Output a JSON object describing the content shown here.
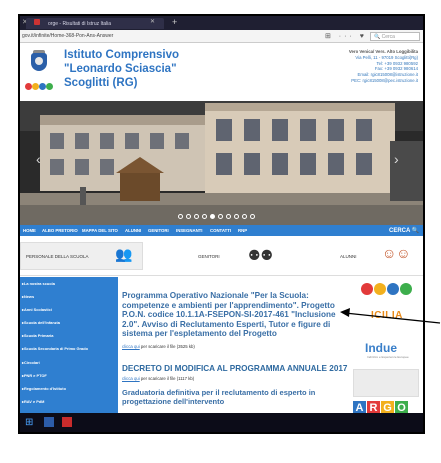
{
  "browser": {
    "tab_title": "orge - Risultati di Istruz Italia",
    "tab_close": "✕",
    "new_tab": "+",
    "url": "gov.it/infinite/Home-368-Pon-Ans-Answer",
    "toolbar_icons": "⊞ ··· ♥ ☆",
    "search_placeholder": "🔍 Cerca"
  },
  "header": {
    "school_line1": "Istituto Comprensivo",
    "school_line2": "\"Leonardo Sciascia\"",
    "school_line3": "Scoglitti (RG)",
    "contact_name": "Vero Venica/ Vers. Alto Loggibilita",
    "contact_lines": [
      "Via Pelli, 11 - 97019 Scoglitti(Rg)",
      "Tel: +39 0932 980592",
      "Fax: +39 0932 980614",
      "Email: rgic815008@istruzione.it",
      "PEC: rgic815008@pec.istruzione.it"
    ],
    "logo_dot_colors": [
      "#e23a3a",
      "#f2b01e",
      "#2e74c2",
      "#3dae4c"
    ]
  },
  "slider": {
    "prev": "‹",
    "next": "›",
    "page_count": 10,
    "active_page": 5
  },
  "nav": {
    "items": [
      "HOME",
      "ALBO PRETORIO",
      "MAPPA DEL SITO",
      "ALUNNI",
      "GENITORI",
      "INSEGNANTI",
      "CONTATTI",
      "RNP"
    ],
    "search_label": "CERCA 🔍"
  },
  "quick": {
    "personale": "PERSONALE DELLA SCUOLA",
    "genitori": "GENITORI",
    "alunni": "ALUNNI"
  },
  "sidebar": {
    "items": [
      "▸La nostra scuola",
      "▸News",
      "▸Anni Scolastici",
      "▸Scuola dell'Infanzia",
      "▸Scuola Primaria",
      "▸Scuola Secondaria di Primo Grado",
      "▸Circolari",
      "▸PNR e PTOF",
      "▸Regolamento d'Istituto",
      "▸RAV e PdM"
    ]
  },
  "content": {
    "article1_title": "Programma Operativo Nazionale \"Per la Scuola: competenze e ambienti per l'apprendimento\". Progetto P.O.N. codice 10.1.1A-FSEPON-SI-2017-461 \"Inclusione 2.0\". Avviso di Reclutamento Esperti, Tutor e figure di sistema per l'espletamento del Progetto",
    "article1_link": "clicca qui",
    "article1_suffix": " per scaricare il file (3525 kb)",
    "article2_title": "DECRETO DI MODIFICA AL PROGRAMMA ANNUALE 2017",
    "article2_link": "clicca qui",
    "article2_suffix": " per scaricare il file (1117 kb)",
    "article3_title": "Graduatoria definitiva per il reclutamento di esperto in progettazione dell'intervento"
  },
  "banners": {
    "sicilia": "ICILIA",
    "indue": "Indue",
    "indue_sub": "Indirizzo e Esperienze Europee",
    "argo": [
      "A",
      "R",
      "G",
      "O"
    ],
    "ooo_colors": [
      "#e23a3a",
      "#f2b01e",
      "#2e74c2",
      "#3dae4c"
    ],
    "argo_colors": [
      "#2e74c2",
      "#e23a3a",
      "#f2b01e",
      "#3dae4c"
    ]
  }
}
